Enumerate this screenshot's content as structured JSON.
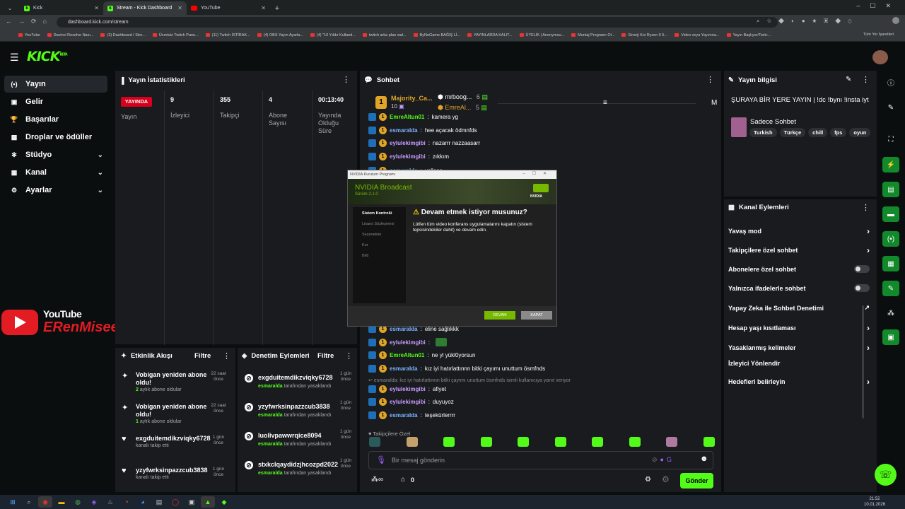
{
  "browser": {
    "tabs": [
      {
        "label": "Kick",
        "active": false
      },
      {
        "label": "Stream - Kick Dashboard",
        "active": true
      },
      {
        "label": "YouTube",
        "active": false
      }
    ],
    "url": "dashboard.kick.com/stream",
    "bookmarks": [
      "YouTube",
      "Davinci Resolve Nası...",
      "(3) Dashboard / Stre...",
      "Ücretsiz Twitch Pane...",
      "(11) Twitch İSTİRAK...",
      "(4) OBS Yayın Ayarla...",
      "(4) \"10 Yıldır Kulland...",
      "twitch arka plan wal...",
      "ByNoGame BAĞIŞ Lİ...",
      "YAYINLARDA KALIT...",
      "ÜYELİK | Anonymou...",
      "Montaj Programı Ol...",
      "Sinerji Koi Ryzen 5 5...",
      "Video veya Yayınına...",
      "Yayın Başlıyor/Twitc..."
    ],
    "bookmarks_all": "Tüm Yer İşaretleri"
  },
  "kick": {
    "logo": "KICK",
    "logo_sup": "BETA"
  },
  "sidebar": {
    "items": [
      {
        "label": "Yayın",
        "icon": "broadcast-icon",
        "active": true,
        "chevron": false
      },
      {
        "label": "Gelir",
        "icon": "money-icon",
        "active": false,
        "chevron": false
      },
      {
        "label": "Başarılar",
        "icon": "trophy-icon",
        "active": false,
        "chevron": false
      },
      {
        "label": "Droplar ve ödüller",
        "icon": "gift-icon",
        "active": false,
        "chevron": false
      },
      {
        "label": "Stüdyo",
        "icon": "studio-icon",
        "active": false,
        "chevron": true
      },
      {
        "label": "Kanal",
        "icon": "user-icon",
        "active": false,
        "chevron": true
      },
      {
        "label": "Ayarlar",
        "icon": "gear-icon",
        "active": false,
        "chevron": true
      }
    ]
  },
  "watermark": {
    "line1": "YouTube",
    "line2": "ERenMisee"
  },
  "stats": {
    "title": "Yayın İstatistikleri",
    "live_badge": "YAYINDA",
    "live_label": "Yayın",
    "columns": [
      {
        "value": "9",
        "label": "İzleyici"
      },
      {
        "value": "355",
        "label": "Takipçi"
      },
      {
        "value": "4",
        "label": "Abone Sayısı"
      },
      {
        "value": "00:13:40",
        "label": "Yayında Olduğu Süre"
      }
    ]
  },
  "chat": {
    "title": "Sohbet",
    "leaders": [
      {
        "rank": "1",
        "name": "Majority_Ca...",
        "count": "10"
      },
      {
        "name": "mrboog...",
        "count": "6"
      },
      {
        "name": "EmreAl...",
        "count": "5"
      }
    ],
    "pinned_initial": "M",
    "messages_top": [
      {
        "user": "EmreAltun01",
        "text": "kamera yg"
      },
      {
        "user": "esmaralda",
        "text": "hee açacak ödmnfds"
      },
      {
        "user": "eylulekimgibi",
        "text": "nazarrr nazzaasarr"
      },
      {
        "user": "eylulekimgibi",
        "text": "zıkkım"
      },
      {
        "user": "esmaralda",
        "text": "yallaaa"
      }
    ],
    "messages_bottom": [
      {
        "user": "esmaralda",
        "text": "eline sağlıkkk",
        "ucls": "u1"
      },
      {
        "user": "eylulekimgibi",
        "text": "",
        "ucls": "u2"
      },
      {
        "user": "EmreAltun01",
        "text": "ne yl yükl0yorsun",
        "ucls": "u3"
      },
      {
        "user": "esmaralda",
        "text": "kız iyi hatırlattınnn bitki çayımı unuttum ösmfnds",
        "ucls": "u1"
      }
    ],
    "reply_note": "esmaralda: kız iyi hatırlattınnn bitki çayımı unuttum ösmfnds isimli kullanıcıya yanıt veriyor",
    "messages_last": [
      {
        "user": "eylulekimgibi",
        "text": "afiyet",
        "ucls": "u2"
      },
      {
        "user": "eylulekimgibi",
        "text": "duyuyoz",
        "ucls": "u2"
      },
      {
        "user": "esmaralda",
        "text": "teşekürlerrrr",
        "ucls": "u1"
      }
    ],
    "followers_only_label": "Takipçilere Özel",
    "input_placeholder": "Bir mesaj gönderin",
    "points": "0",
    "send": "Gönder"
  },
  "dialog": {
    "window_title": "NVIDIA Kurulum Programı",
    "product": "NVIDIA Broadcast",
    "version": "Sürüm 2.1.0",
    "logo": "NVIDIA",
    "steps": [
      "Sistem Kontrolü",
      "Lisans Sözleşmesi",
      "Seçenekler",
      "Kur",
      "Bitti"
    ],
    "question": "Devam etmek istiyor musunuz?",
    "body": "Lütfen tüm video konferans uygulamalarını kapatın (sistem tepsisindekiler dahil) ve devam edin.",
    "btn_continue": "DEVAM",
    "btn_close": "KAPAT"
  },
  "stream_info": {
    "title": "Yayın bilgisi",
    "stream_title": "ŞURAYA BİR YERE YAYIN | !dc !bynı !insta iyt",
    "category": "Sadece Sohbet",
    "tags": [
      "Turkish",
      "Türkçe",
      "chill",
      "fps",
      "oyun"
    ]
  },
  "channel_actions": {
    "title": "Kanal Eylemleri",
    "items": [
      {
        "label": "Yavaş mod",
        "control": "chevron"
      },
      {
        "label": "Takipçilere özel sohbet",
        "control": "chevron"
      },
      {
        "label": "Abonelere özel sohbet",
        "control": "toggle"
      },
      {
        "label": "Yalnızca ifadelerle sohbet",
        "control": "toggle"
      },
      {
        "label": "Yapay Zeka ile Sohbet Denetimi",
        "control": "external"
      },
      {
        "label": "Hesap yaşı kısıtlaması",
        "control": "chevron"
      },
      {
        "label": "Yasaklanmış kelimeler",
        "control": "chevron"
      },
      {
        "label": "İzleyici Yönlendir",
        "control": "none"
      },
      {
        "label": "Hedefleri belirleyin",
        "control": "chevron"
      }
    ]
  },
  "activity": {
    "title": "Etkinlik Akışı",
    "filter": "Filtre",
    "items": [
      {
        "title": "Vobigan yeniden abone oldu!",
        "sub_num": "2",
        "sub": "aylık abone oldular",
        "time": "22 saat önce",
        "icon": "sparkle-icon"
      },
      {
        "title": "Vobigan yeniden abone oldu!",
        "sub_num": "1",
        "sub": "aylık abone oldular",
        "time": "22 saat önce",
        "icon": "sparkle-icon"
      },
      {
        "title": "exgduitemdikzviqky6728",
        "sub_num": "",
        "sub": "kanalı takip etti",
        "time": "1 gün önce",
        "icon": "heart-icon"
      },
      {
        "title": "yzyfwrksinpazzcub3838",
        "sub_num": "",
        "sub": "kanalı takip etti",
        "time": "1 gün önce",
        "icon": "heart-icon"
      }
    ]
  },
  "moderation": {
    "title": "Denetim Eylemleri",
    "filter": "Filtre",
    "items": [
      {
        "user": "exgduitemdikzviqky6728",
        "by": "esmaralda",
        "suffix": "tarafından yasaklandı",
        "time": "1 gün önce"
      },
      {
        "user": "yzyfwrksinpazzcub3838",
        "by": "esmaralda",
        "suffix": "tarafından yasaklandı",
        "time": "1 gün önce"
      },
      {
        "user": "luolivpawwrqice8094",
        "by": "esmaralda",
        "suffix": "tarafından yasaklandı",
        "time": "1 gün önce"
      },
      {
        "user": "stxkclqaydidzjhcozpd2022",
        "by": "esmaralda",
        "suffix": "tarafından yasaklandı",
        "time": "1 gün önce"
      }
    ]
  },
  "taskbar": {
    "time": "21:52",
    "date": "10.01.2026"
  },
  "colors": {
    "kick_green": "#53fc18",
    "live_red": "#d6001c",
    "panel": "#191b1f"
  }
}
